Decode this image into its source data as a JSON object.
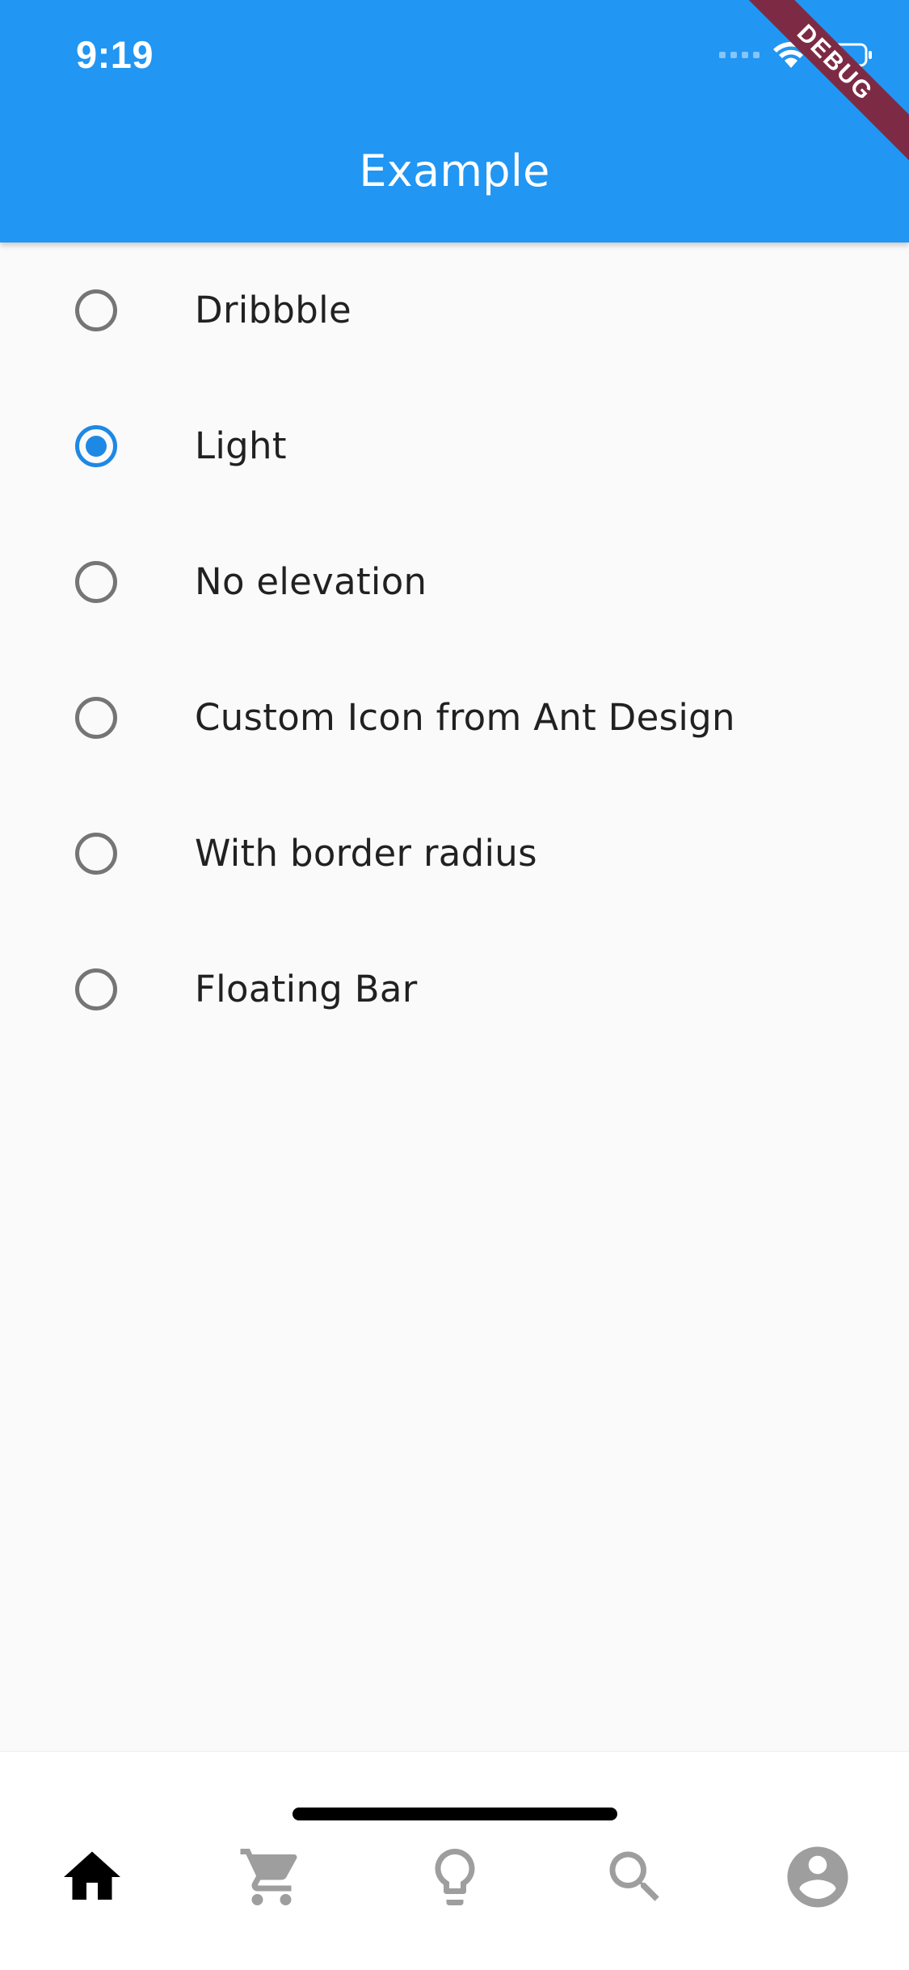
{
  "status_bar": {
    "time": "9:19",
    "icons": [
      "signal-icon",
      "wifi-icon",
      "battery-icon"
    ]
  },
  "app_bar": {
    "title": "Example",
    "debug_banner": "DEBUG",
    "color": "#2196f3"
  },
  "options": [
    {
      "label": "Dribbble",
      "checked": false
    },
    {
      "label": "Light",
      "checked": true
    },
    {
      "label": "No elevation",
      "checked": false
    },
    {
      "label": "Custom Icon from Ant Design",
      "checked": false
    },
    {
      "label": "With border radius",
      "checked": false
    },
    {
      "label": "Floating Bar",
      "checked": false
    }
  ],
  "bottom_nav": {
    "items": [
      {
        "icon": "home-icon",
        "active": true
      },
      {
        "icon": "cart-icon",
        "active": false
      },
      {
        "icon": "lightbulb-icon",
        "active": false
      },
      {
        "icon": "search-icon",
        "active": false
      },
      {
        "icon": "account-icon",
        "active": false
      }
    ],
    "active_color": "#000000",
    "inactive_color": "#9e9e9e"
  },
  "colors": {
    "radio_selected": "#1e88e5",
    "radio_unselected": "#757575",
    "background": "#fafafa"
  }
}
